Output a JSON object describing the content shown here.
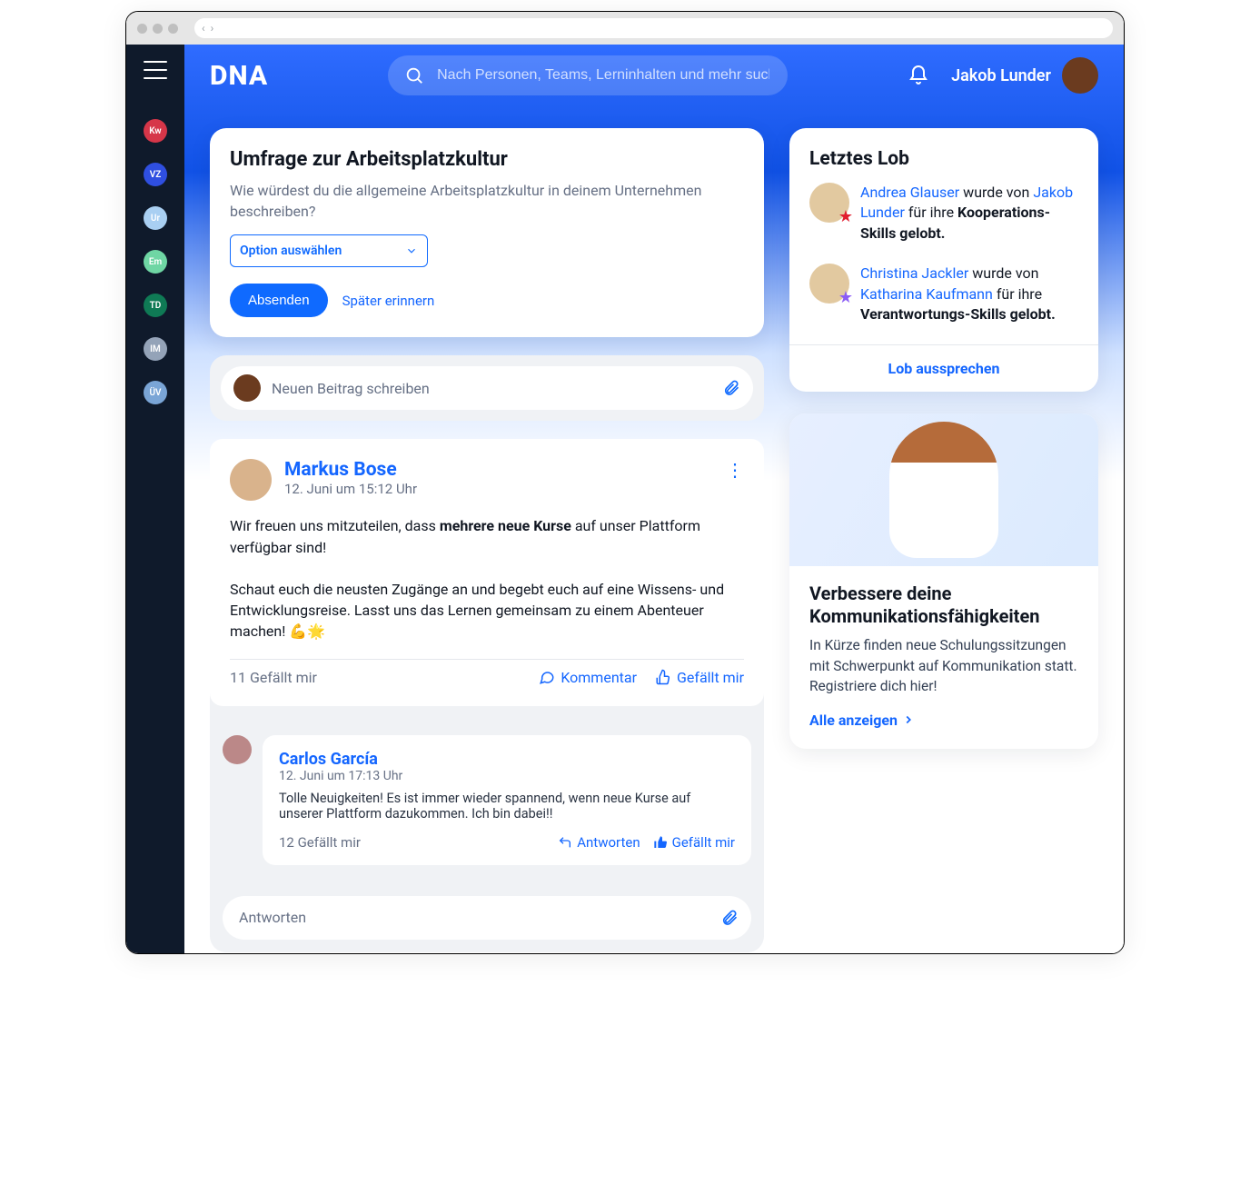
{
  "rail": {
    "items": [
      {
        "label": "Kw",
        "bg": "#d63649"
      },
      {
        "label": "VZ",
        "bg": "#2f4fe0"
      },
      {
        "label": "Ur",
        "bg": "#a9cff2"
      },
      {
        "label": "Em",
        "bg": "#6fd6a4"
      },
      {
        "label": "TD",
        "bg": "#0f7a55"
      },
      {
        "label": "IM",
        "bg": "#94a3b8"
      },
      {
        "label": "ÜV",
        "bg": "#7aa5d6"
      }
    ]
  },
  "header": {
    "logo": "DNA",
    "search_placeholder": "Nach Personen, Teams, Lerninhalten und mehr such...",
    "user_name": "Jakob Lunder"
  },
  "survey": {
    "title": "Umfrage zur Arbeitsplatzkultur",
    "question": "Wie würdest du die allgemeine Arbeitsplatzkultur in deinem Unternehmen beschreiben?",
    "select_label": "Option auswählen",
    "submit_label": "Absenden",
    "remind_label": "Später erinnern"
  },
  "compose": {
    "placeholder": "Neuen Beitrag schreiben"
  },
  "post": {
    "author": "Markus Bose",
    "timestamp": "12. Juni um 15:12 Uhr",
    "body_pre": "Wir freuen uns mitzuteilen, dass ",
    "body_bold": "mehrere neue Kurse",
    "body_post": " auf unser Plattform verfügbar sind!",
    "body_p2": "Schaut euch die neusten Zugänge an und begebt euch auf eine Wissens- und Entwicklungsreise. Lasst uns das Lernen gemeinsam zu einem Abenteuer machen! 💪🌟",
    "likes": "11 Gefällt mir",
    "comment_label": "Kommentar",
    "like_label": "Gefällt mir"
  },
  "comment": {
    "author": "Carlos García",
    "timestamp": "12. Juni um 17:13 Uhr",
    "text": "Tolle Neuigkeiten! Es ist immer wieder spannend, wenn neue Kurse auf unserer Plattform dazukommen. Ich bin dabei!!",
    "likes": "12 Gefällt mir",
    "reply_label": "Antworten",
    "like_label": "Gefällt mir"
  },
  "reply": {
    "placeholder": "Antworten"
  },
  "praise": {
    "title": "Letztes Lob",
    "items": [
      {
        "person": "Andrea Glauser",
        "middle": " wurde von ",
        "by": "Jakob Lunder",
        "for_pre": " für ihre ",
        "skill": "Kooperations-Skills gelobt.",
        "star_color": "#e11d2e"
      },
      {
        "person": "Christina Jackler",
        "middle": " wurde von ",
        "by": "Katharina Kaufmann",
        "for_pre": " für ihre ",
        "skill": "Verantwortungs-Skills gelobt.",
        "star_color": "#8b5cf6"
      }
    ],
    "footer": "Lob aussprechen"
  },
  "promo": {
    "title": "Verbessere deine Kommunikationsfähigkeiten",
    "text": "In Kürze finden neue Schulungssitzungen mit Schwerpunkt auf Kommunikation statt.\nRegistriere dich hier!",
    "cta": "Alle anzeigen"
  }
}
